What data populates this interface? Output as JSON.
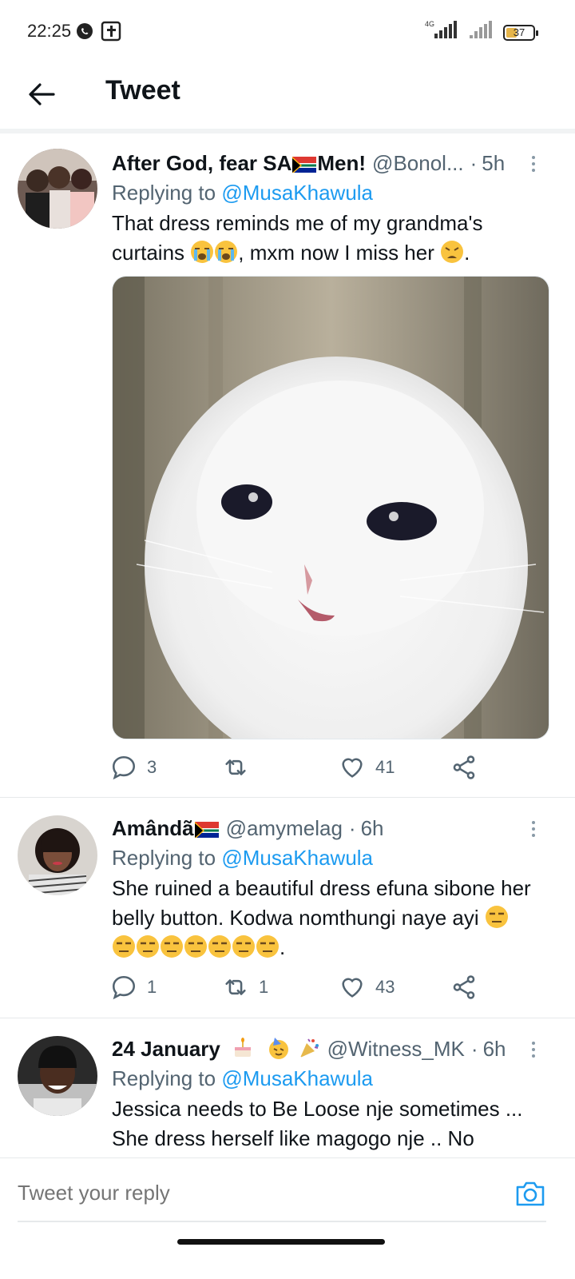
{
  "status_bar": {
    "time": "22:25",
    "network": "4G",
    "battery": "37",
    "battery_level": 0.37
  },
  "header": {
    "title": "Tweet"
  },
  "tweets": [
    {
      "name": "After God, fear SA",
      "name_suffix": "Men!",
      "handle": "@Bonol...",
      "dot": "·",
      "time": "5h",
      "replying_prefix": "Replying to",
      "replying_to": "@MusaKhawula",
      "text_1": "That dress reminds me of my grandma's curtains",
      "text_2": ", mxm now I miss her",
      "text_3": ".",
      "reply_count": "3",
      "retweet_count": "",
      "like_count": "41"
    },
    {
      "name": "Amândã",
      "handle": "@amymelag",
      "dot": "·",
      "time": "6h",
      "replying_prefix": "Replying to",
      "replying_to": "@MusaKhawula",
      "text_1": "She ruined a beautiful dress efuna sibone her belly button. Kodwa nomthungi naye ayi",
      "text_2": ".",
      "reply_count": "1",
      "retweet_count": "1",
      "like_count": "43"
    },
    {
      "name": "24 January",
      "handle": "@Witness_MK",
      "dot": "·",
      "time": "6h",
      "replying_prefix": "Replying to",
      "replying_to": "@MusaKhawula",
      "text_1": "Jessica needs to Be Loose nje sometimes ...",
      "text_2": "She dress herself like magogo nje .. No"
    }
  ],
  "reply_bar": {
    "placeholder": "Tweet your reply"
  },
  "colors": {
    "accent": "#1d9bf0",
    "text": "#0f1419",
    "muted": "#536471"
  }
}
